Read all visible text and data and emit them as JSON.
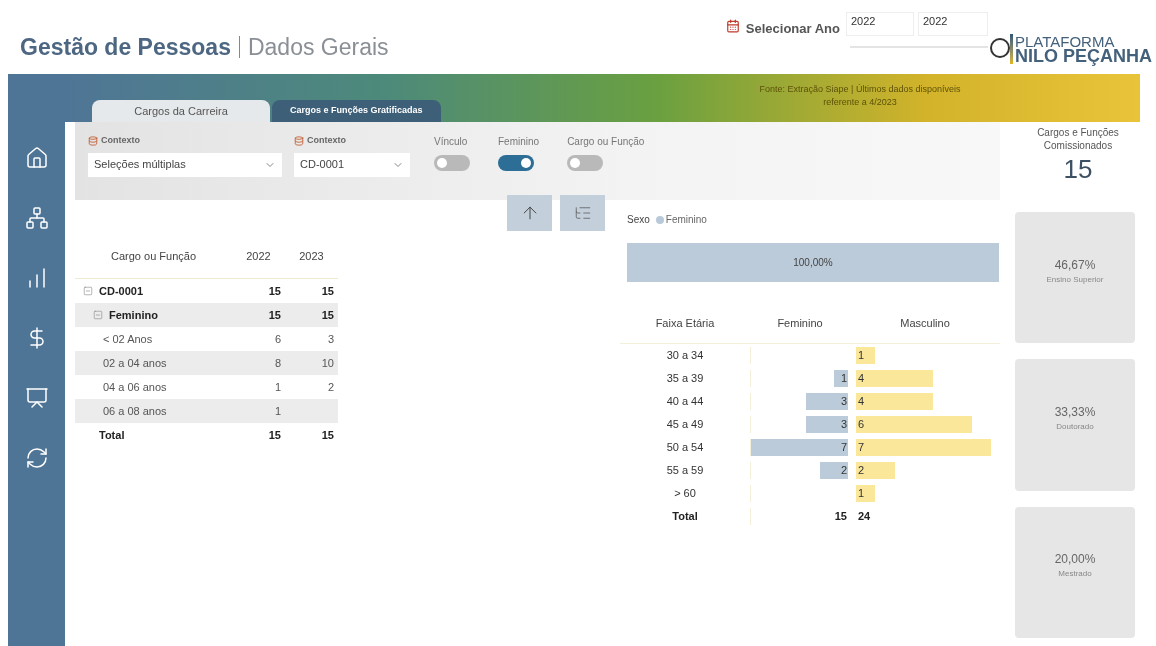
{
  "header": {
    "title": "Gestão de Pessoas",
    "subtitle": "Dados Gerais",
    "year_filter": {
      "label": "Selecionar Ano",
      "from": "2022",
      "to": "2022",
      "level": 1
    },
    "logo": {
      "line1": "PLATAFORMA",
      "line2": "NILO PEÇANHA"
    }
  },
  "banner": {
    "note": "Fonte: Extração Siape | Últimos dados disponíveis referente a 4/2023"
  },
  "tabs": [
    {
      "label": "Cargos da Carreira",
      "selected": false
    },
    {
      "label": "Cargos e Funções Gratificadas",
      "selected": true
    }
  ],
  "slicers": [
    {
      "label": "Contexto",
      "value": "Seleções múltiplas"
    },
    {
      "label": "Contexto",
      "value": "CD-0001"
    }
  ],
  "toggles": [
    {
      "label": "Vínculo",
      "on": false
    },
    {
      "label": "Feminino",
      "on": true
    },
    {
      "label": "Cargo ou Função",
      "on": false
    }
  ],
  "kpi": {
    "label": "Cargos e Funções Comissionados",
    "value": "15"
  },
  "table": {
    "columns": [
      "Cargo ou Função",
      "2022",
      "2023"
    ],
    "rows": [
      {
        "label": "CD-0001",
        "values": [
          "15",
          "15"
        ],
        "expanded": true,
        "children": [
          {
            "label": "Feminino",
            "values": [
              "15",
              "15"
            ],
            "expanded": true,
            "children": [
              {
                "label": "< 02 Anos",
                "values": [
                  "6",
                  "3"
                ]
              },
              {
                "label": "02 a 04 anos",
                "values": [
                  "8",
                  "10"
                ]
              },
              {
                "label": "04 a 06 anos",
                "values": [
                  "1",
                  "2"
                ]
              },
              {
                "label": "06 a 08 anos",
                "values": [
                  "1"
                ]
              }
            ]
          }
        ]
      }
    ],
    "total": {
      "label": "Total",
      "values": [
        "15",
        "15"
      ]
    }
  },
  "pyramid": {
    "legend": {
      "title": "Sexo",
      "items": [
        {
          "label": "Feminino",
          "color": "#b8c9d9"
        }
      ]
    },
    "share_bar": {
      "label": "100,00%"
    },
    "columns": [
      "Faixa Etária",
      "Feminino",
      "Masculino"
    ],
    "rows": [
      {
        "band": "30 a 34",
        "male": "1"
      },
      {
        "band": "35 a 39",
        "female": "1",
        "male": "4"
      },
      {
        "band": "40 a 44",
        "female": "3",
        "male": "4"
      },
      {
        "band": "45 a 49",
        "female": "3",
        "male": "6"
      },
      {
        "band": "50 a 54",
        "female": "7",
        "male": "7"
      },
      {
        "band": "55 a 59",
        "female": "2",
        "male": "2"
      },
      {
        "band": "> 60",
        "male": "1"
      }
    ],
    "total": {
      "label": "Total",
      "female": "15",
      "male": "24"
    }
  },
  "cards": [
    {
      "value": "46,67%",
      "label": "Ensino Superior"
    },
    {
      "value": "33,33%",
      "label": "Doutorado"
    },
    {
      "value": "20,00%",
      "label": "Mestrado"
    }
  ]
}
